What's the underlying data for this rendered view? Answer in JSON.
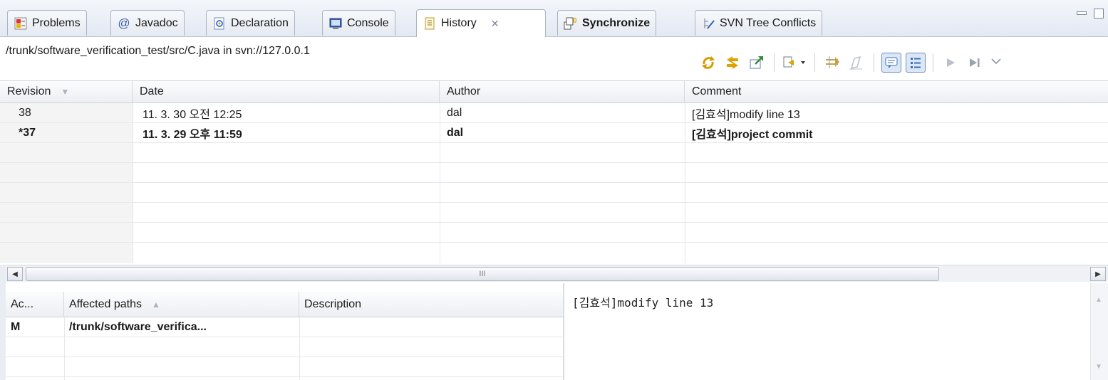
{
  "tabs": [
    {
      "label": "Problems",
      "icon": "problems-icon"
    },
    {
      "label": "Javadoc",
      "icon": "at-icon"
    },
    {
      "label": "Declaration",
      "icon": "declaration-icon"
    },
    {
      "label": "Console",
      "icon": "console-icon"
    },
    {
      "label": "History",
      "icon": "history-icon",
      "active": true
    },
    {
      "label": "Synchronize",
      "icon": "synchronize-icon",
      "bold": true
    },
    {
      "label": "SVN Tree Conflicts",
      "icon": "svn-tree-conflicts-icon"
    }
  ],
  "path": "/trunk/software_verification_test/src/C.java in svn://127.0.0.1",
  "columns": {
    "revision": "Revision",
    "date": "Date",
    "author": "Author",
    "comment": "Comment"
  },
  "rows": [
    {
      "revision": "38",
      "date": "11. 3. 30 오전 12:25",
      "author": "dal",
      "comment": "[김효석]modify line 13",
      "bold": false
    },
    {
      "revision": "*37",
      "date": "11. 3. 29 오후 11:59",
      "author": "dal",
      "comment": "[김효석]project commit",
      "bold": true
    }
  ],
  "scrollbar_grip": "III",
  "lower": {
    "columns": {
      "action": "Ac...",
      "affected_paths": "Affected paths",
      "description": "Description"
    },
    "rows": [
      {
        "action": "M",
        "path": "/trunk/software_verifica...",
        "description": ""
      }
    ],
    "comment_text": "[김효석]modify line 13"
  },
  "colors": {
    "accent": "#6b8fc4",
    "tab_border": "#a9b4c4",
    "header_bg": "#eceff3"
  }
}
